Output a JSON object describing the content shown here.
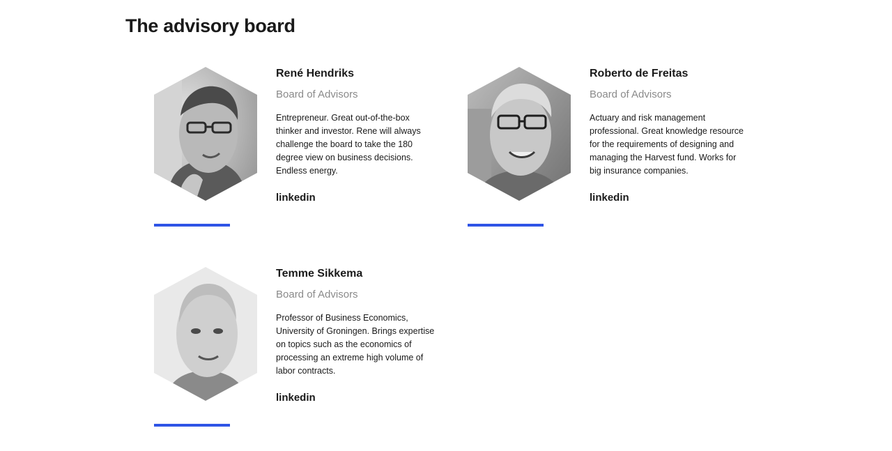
{
  "section": {
    "title": "The advisory board"
  },
  "members": [
    {
      "name": "René Hendriks",
      "role": "Board of Advisors",
      "bio": "Entrepreneur. Great out-of-the-box thinker and investor. Rene will always challenge the board to take the 180 degree view on business decisions. Endless energy.",
      "link_label": "linkedin"
    },
    {
      "name": "Roberto de Freitas",
      "role": "Board of Advisors",
      "bio": "Actuary and risk management professional. Great knowledge resource for the requirements of designing and managing the Harvest fund. Works for big insurance companies.",
      "link_label": "linkedin"
    },
    {
      "name": "Temme Sikkema",
      "role": "Board of Advisors",
      "bio": "Professor of Business Economics, University of Groningen. Brings expertise on topics such as the economics of processing an extreme high volume of labor contracts.",
      "link_label": "linkedin"
    }
  ],
  "colors": {
    "accent": "#2f54e6",
    "role_text": "#8a8a8a",
    "heading": "#1a1a1a"
  }
}
